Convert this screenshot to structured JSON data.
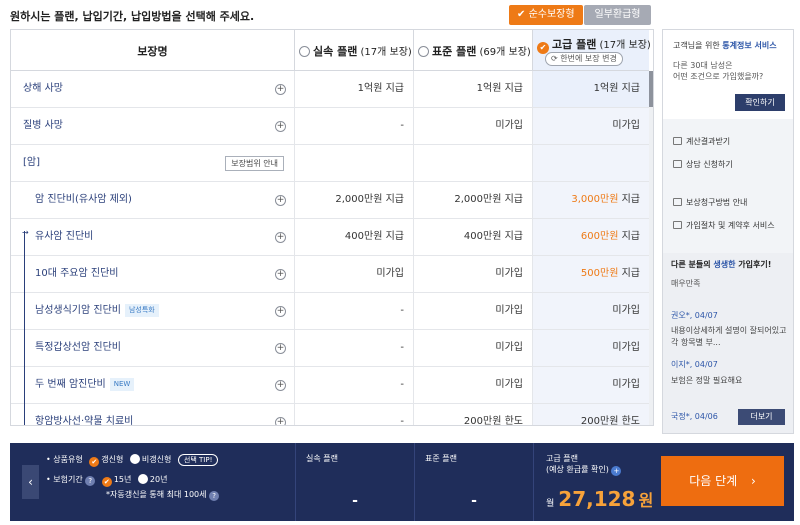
{
  "instruction": "원하시는 플랜, 납입기간, 납입방법을 선택해 주세요.",
  "top_buttons": {
    "pure": "순수보장형",
    "refund": "일부환급형"
  },
  "table": {
    "header": {
      "name": "보장명",
      "plan1": {
        "name": "실속 플랜",
        "count": "(17개 보장)"
      },
      "plan2": {
        "name": "표준 플랜",
        "count": "(69개 보장)"
      },
      "plan3": {
        "name": "고급 플랜",
        "count": "(17개 보장)",
        "change": "한번에 보장 변경"
      }
    },
    "rows": [
      {
        "name": "상해 사망",
        "v1": "1억원 지급",
        "v2": "1억원 지급",
        "v3": "1억원 지급"
      },
      {
        "name": "질병 사망",
        "v1": "-",
        "v2": "미가입",
        "v3": "미가입"
      },
      {
        "name": "[암]",
        "range_btn": "보장범위 안내"
      },
      {
        "name": "암 진단비(유사암 제외)",
        "v1": "2,000만원 지급",
        "v2": "2,000만원 지급",
        "v3_hl": "3,000만원",
        "v3_suffix": " 지급"
      },
      {
        "name": "유사암 진단비",
        "v1": "400만원 지급",
        "v2": "400만원 지급",
        "v3_hl": "600만원",
        "v3_suffix": " 지급"
      },
      {
        "name": "10대 주요암 진단비",
        "v1": "미가입",
        "v2": "미가입",
        "v3_hl": "500만원",
        "v3_suffix": " 지급"
      },
      {
        "name": "남성생식기암 진단비",
        "tag": "남성특화",
        "v1": "-",
        "v2": "미가입",
        "v3": "미가입"
      },
      {
        "name": "특정갑상선암 진단비",
        "v1": "-",
        "v2": "미가입",
        "v3": "미가입"
      },
      {
        "name": "두 번째 암진단비",
        "tag": "NEW",
        "v1": "-",
        "v2": "미가입",
        "v3": "미가입"
      },
      {
        "name": "항암방사선·약물 치료비",
        "v1": "-",
        "v2": "200만원 한도",
        "v3": "200만원 한도"
      }
    ]
  },
  "sidebar": {
    "title_prefix": "고객님을 위한 ",
    "title_highlight": "통계정보 서비스",
    "question1": "다른 30대 남성은",
    "question2": "어떤 조건으로 가입했을까?",
    "confirm": "확인하기",
    "menu": [
      "계산결과받기",
      "상담 신청하기",
      "보상청구방법 안내",
      "가입절차 및 계약후 서비스"
    ],
    "reviews_title_prefix": "다른 분들의 ",
    "reviews_title_highlight": "생생한",
    "reviews_title_suffix": " 가입후기!",
    "reviews_sub": "매우만족",
    "reviews": [
      {
        "author": "권오*, 04/07",
        "text": "내용이상세하게 설명이 잘되어있고 각 항목별 부..."
      },
      {
        "author": "이지*, 04/07",
        "text": "보험은 정말 필요해요"
      },
      {
        "author": "국정*, 04/06",
        "text": ""
      }
    ],
    "more": "더보기"
  },
  "bottom": {
    "type_label": "상품유형",
    "type_opt1": "갱신형",
    "type_opt2": "비갱신형",
    "tip": "선택 TIP!",
    "period_label": "보험기간",
    "period_opt1": "15년",
    "period_opt2": "20년",
    "note": "*자동갱신을 통해 최대 100세",
    "plan1": "실속 플랜",
    "plan2": "표준 플랜",
    "plan1_price": "-",
    "plan2_price": "-",
    "plan3_label1": "고급 플랜",
    "plan3_label2": "(예상 환급률 확인)",
    "month": "월",
    "price": "27,128",
    "won": "원",
    "next": "다음 단계"
  }
}
